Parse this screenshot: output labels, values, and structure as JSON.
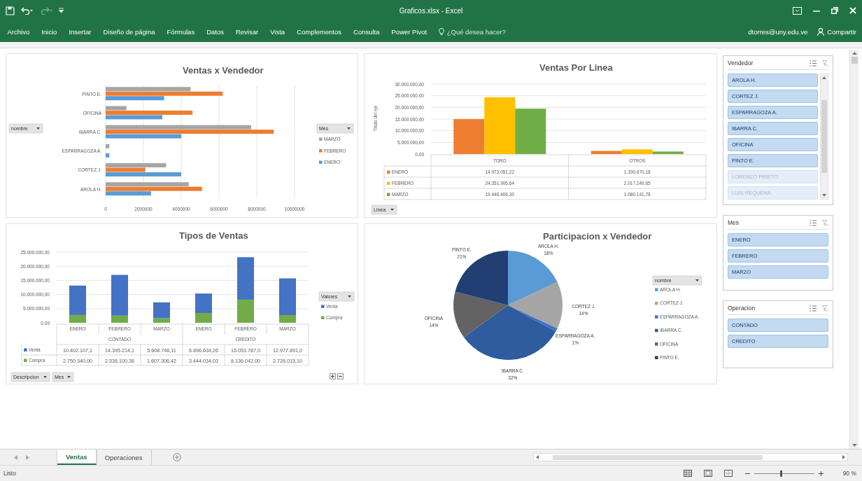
{
  "window": {
    "title": "Graficos.xlsx - Excel"
  },
  "ribbon": {
    "tabs": [
      "Archivo",
      "Inicio",
      "Insertar",
      "Diseño de página",
      "Fórmulas",
      "Datos",
      "Revisar",
      "Vista",
      "Complementos",
      "Consulta",
      "Power Pivot"
    ],
    "tell_me": {
      "placeholder": "¿Qué desea hacer?"
    },
    "account": "dtorres@uny.edu.ve",
    "share": "Compartir"
  },
  "charts": {
    "ventas_vendedor": {
      "axis_filter": "nombre",
      "legend_filter": "Mes",
      "chart_data": {
        "type": "bar",
        "orientation": "horizontal",
        "title": "Ventas x Vendedor",
        "grid": true,
        "legend": true,
        "categories": [
          "PINTO E.",
          "OFICINA",
          "IBARRA C.",
          "ESPARRAGOZA A.",
          "CORTEZ J.",
          "AROLA H."
        ],
        "series": [
          {
            "name": "MARZO",
            "color": "#a5a5a5",
            "values": [
              4500000,
              1100000,
              7700000,
              200000,
              3200000,
              4400000
            ]
          },
          {
            "name": "FEBRERO",
            "color": "#ed7d31",
            "values": [
              6200000,
              4600000,
              8900000,
              0,
              2100000,
              5100000
            ]
          },
          {
            "name": "ENERO",
            "color": "#5b9bd5",
            "values": [
              3100000,
              3000000,
              4000000,
              200000,
              4000000,
              2400000
            ]
          }
        ],
        "xlim": [
          0,
          10000000
        ],
        "xticks": [
          0,
          2000000,
          4000000,
          6000000,
          8000000,
          10000000
        ]
      }
    },
    "ventas_linea": {
      "axis_filter": "Linea",
      "chart_data": {
        "type": "bar",
        "title": "Ventas Por Linea",
        "ylabel": "Título del eje",
        "grid": true,
        "legend": true,
        "categories": [
          "TORO",
          "OTROS"
        ],
        "series": [
          {
            "name": "ENERO",
            "color": "#ed7d31",
            "values": [
              14973051.22,
              1330670.18
            ]
          },
          {
            "name": "FEBRERO",
            "color": "#ffc000",
            "values": [
              24351906.64,
              2017249.65
            ]
          },
          {
            "name": "MARZO",
            "color": "#70ad47",
            "values": [
              19446406.3,
              1080141.78
            ]
          }
        ],
        "ylim": [
          0,
          30000000
        ],
        "yticks": [
          {
            "value": 0,
            "label": "0,00"
          },
          {
            "value": 5000000,
            "label": "5.000.000,00"
          },
          {
            "value": 10000000,
            "label": "10.000.000,00"
          },
          {
            "value": 15000000,
            "label": "15.000.000,00"
          },
          {
            "value": 20000000,
            "label": "20.000.000,00"
          },
          {
            "value": 25000000,
            "label": "25.000.000,00"
          },
          {
            "value": 30000000,
            "label": "30.000.000,00"
          }
        ],
        "value_labels": [
          [
            "14.973.051,22",
            "1.330.670,18"
          ],
          [
            "24.351.906,64",
            "2.017.249,65"
          ],
          [
            "19.446.406,30",
            "1.080.141,78"
          ]
        ]
      }
    },
    "tipos_ventas": {
      "category_groups": [
        "CONTADO",
        "CREDITO"
      ],
      "filters": [
        "Descripcion",
        "Mes"
      ],
      "legend_filter": "Valores",
      "chart_data": {
        "type": "bar",
        "stacked": true,
        "title": "Tipos de Ventas",
        "grid": true,
        "legend": true,
        "categories": [
          "ENERO",
          "FEBRERO",
          "MARZO",
          "ENERO",
          "FEBRERO",
          "MARZO"
        ],
        "series": [
          {
            "name": "Venta",
            "color": "#4472c4",
            "values": [
              10402107.1,
              14395214.1,
              5608746.11,
              6896634.26,
              15053787.0,
              12977891.0
            ]
          },
          {
            "name": "Compra",
            "color": "#70ad47",
            "values": [
              2750340.0,
              2536100.36,
              1607306.42,
              3444034.03,
              8136042.0,
              2726015.1
            ]
          }
        ],
        "ylim": [
          0,
          25000000
        ],
        "yticks": [
          {
            "value": 0,
            "label": "0,00"
          },
          {
            "value": 5000000,
            "label": "5.000.000,00"
          },
          {
            "value": 10000000,
            "label": "10.000.000,00"
          },
          {
            "value": 15000000,
            "label": "15.000.000,00"
          },
          {
            "value": 20000000,
            "label": "20.000.000,00"
          },
          {
            "value": 25000000,
            "label": "25.000.000,00"
          }
        ],
        "value_labels": [
          [
            "10.402.107,1",
            "14.395.214,1",
            "5.608.746,11",
            "6.896.634,26",
            "15.053.787,0",
            "12.977.891,0"
          ],
          [
            "2.750.340,00",
            "2.536.100,36",
            "1.607.306,42",
            "3.444.034,03",
            "8.136.042,00",
            "2.726.015,10"
          ]
        ]
      }
    },
    "participacion": {
      "legend_filter": "nombre",
      "chart_data": {
        "type": "pie",
        "title": "Participacion x Vendedor",
        "legend": true,
        "categories": [
          "AROLA H.",
          "CORTEZ J.",
          "ESPARRAGOZA A.",
          "IBARRA C.",
          "OFICINA",
          "PINTO E."
        ],
        "series": [
          {
            "colors": [
              "#5b9bd5",
              "#a5a5a5",
              "#4472c4",
              "#2e5c9e",
              "#636363",
              "#223f73"
            ],
            "values": [
              18,
              14,
              1,
              32,
              14,
              21
            ]
          }
        ],
        "value_labels": [
          "18%",
          "14%",
          "1%",
          "32%",
          "14%",
          "21%"
        ]
      }
    }
  },
  "slicers": [
    {
      "title": "Vendedor",
      "scrollable": true,
      "items": [
        {
          "label": "AROLA H.",
          "selected": true,
          "disabled": false
        },
        {
          "label": "CORTEZ J.",
          "selected": true,
          "disabled": false
        },
        {
          "label": "ESPARRAGOZA A.",
          "selected": true,
          "disabled": false
        },
        {
          "label": "IBARRA C.",
          "selected": true,
          "disabled": false
        },
        {
          "label": "OFICINA",
          "selected": true,
          "disabled": false
        },
        {
          "label": "PINTO E.",
          "selected": true,
          "disabled": false
        },
        {
          "label": "LORENZO PRIETO",
          "selected": true,
          "disabled": true
        },
        {
          "label": "LUIS REQUENA",
          "selected": true,
          "disabled": true
        }
      ]
    },
    {
      "title": "Mes",
      "scrollable": false,
      "items": [
        {
          "label": "ENERO",
          "selected": true,
          "disabled": false
        },
        {
          "label": "FEBRERO",
          "selected": true,
          "disabled": false
        },
        {
          "label": "MARZO",
          "selected": true,
          "disabled": false
        }
      ]
    },
    {
      "title": "Operacion",
      "scrollable": false,
      "items": [
        {
          "label": "CONTADO",
          "selected": true,
          "disabled": false
        },
        {
          "label": "CREDITO",
          "selected": true,
          "disabled": false
        }
      ]
    }
  ],
  "sheet_tabs": [
    {
      "label": "Ventas",
      "selected": true
    },
    {
      "label": "Operaciones",
      "selected": false
    }
  ],
  "status_bar": {
    "status": "Listo",
    "zoom": {
      "level": 0.45,
      "label": "90 %"
    }
  }
}
